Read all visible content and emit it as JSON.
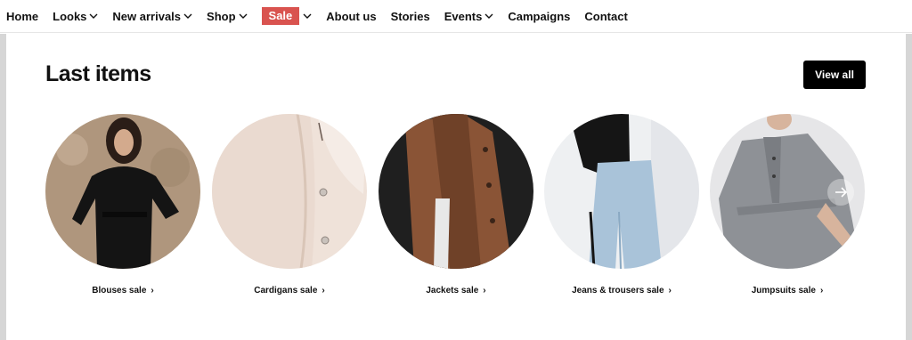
{
  "nav": {
    "items": [
      {
        "label": "Home",
        "has_dropdown": false
      },
      {
        "label": "Looks",
        "has_dropdown": true
      },
      {
        "label": "New arrivals",
        "has_dropdown": true
      },
      {
        "label": "Shop",
        "has_dropdown": true
      },
      {
        "label": "Sale",
        "has_dropdown": true,
        "highlight_color": "#d9534f"
      },
      {
        "label": "About us",
        "has_dropdown": false
      },
      {
        "label": "Stories",
        "has_dropdown": false
      },
      {
        "label": "Events",
        "has_dropdown": true
      },
      {
        "label": "Campaigns",
        "has_dropdown": false
      },
      {
        "label": "Contact",
        "has_dropdown": false
      }
    ]
  },
  "section": {
    "title": "Last items",
    "view_all_label": "View all"
  },
  "categories": [
    {
      "label": "Blouses sale",
      "icon": "chevron-right-icon"
    },
    {
      "label": "Cardigans sale",
      "icon": "chevron-right-icon"
    },
    {
      "label": "Jackets sale",
      "icon": "chevron-right-icon"
    },
    {
      "label": "Jeans & trousers sale",
      "icon": "chevron-right-icon"
    },
    {
      "label": "Jumpsuits sale",
      "icon": "chevron-right-icon"
    }
  ],
  "carousel": {
    "next_icon": "arrow-right-icon"
  },
  "colors": {
    "sale_badge": "#d9534f",
    "button_bg": "#000000",
    "rail": "#d6d6d6"
  }
}
